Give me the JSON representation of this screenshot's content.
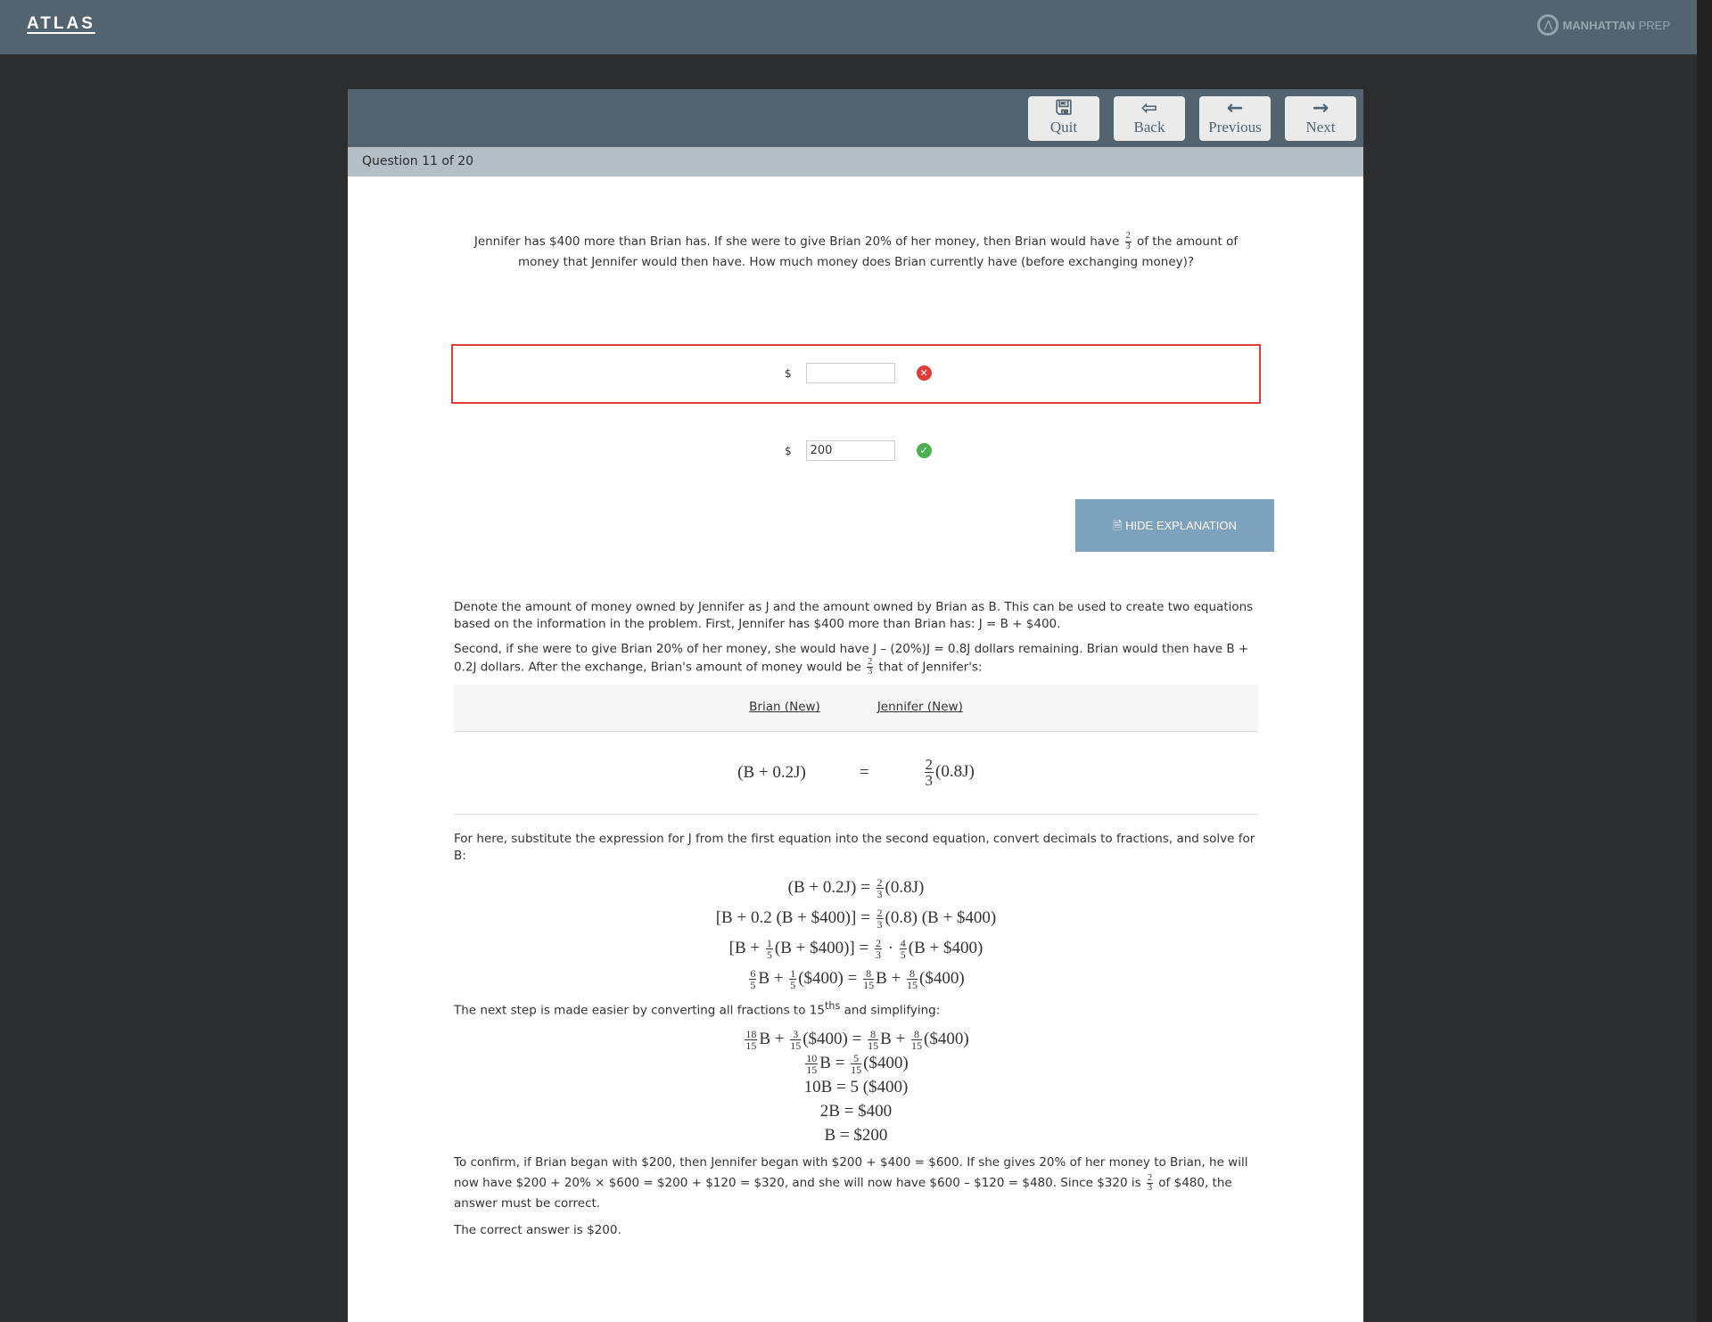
{
  "header": {
    "logo": "ATLAS",
    "brand": "MANHATTAN",
    "brand2": "PREP"
  },
  "toolbar": {
    "quit": "Quit",
    "back": "Back",
    "previous": "Previous",
    "next": "Next"
  },
  "question_bar": {
    "label": "Question 11 of 20"
  },
  "question": {
    "part1": "Jennifer has $400 more than Brian has. If she were to give Brian 20% of her money, then Brian would have",
    "frac_n": "2",
    "frac_d": "3",
    "part2": "of the amount of money that Jennifer would then have. How much money does Brian currently have (before exchanging money)?"
  },
  "answers": [
    {
      "currency": "$",
      "value": "",
      "status": "incorrect"
    },
    {
      "currency": "$",
      "value": "200",
      "status": "correct"
    }
  ],
  "colors": {
    "incorrect": "#e03c3c",
    "correct": "#4caf50",
    "accent": "#7da2bd"
  },
  "hide_button": "HIDE EXPLANATION",
  "explanation": {
    "p1": "Denote the amount of money owned by Jennifer as J and the amount owned by Brian as B. This can be used to create two equations based on the information in the problem. First, Jennifer has $400 more than Brian has: J = B + $400.",
    "p2a": "Second, if she were to give Brian 20% of her money, she would have J – (20%)J = 0.8J dollars remaining. Brian would then have B + 0.2J dollars. After the exchange, Brian's amount of money would be",
    "p2b": "that of Jennifer's:",
    "table": {
      "col1": "Brian (New)",
      "col2": "Jennifer (New)",
      "lhs": "(B + 0.2J)",
      "eq": "=",
      "rhs": "(0.8J)"
    },
    "p3": "For here, substitute the expression for J from the first equation into the second equation, convert decimals to fractions, and solve for B:",
    "eqs1": [
      [
        "(B + 0.2J) = ",
        {
          "n": "2",
          "d": "3"
        },
        "(0.8J)"
      ],
      [
        "[B + 0.2 (B + $400)] = ",
        {
          "n": "2",
          "d": "3"
        },
        "(0.8) (B + $400)"
      ],
      [
        "[B + ",
        {
          "n": "1",
          "d": "5"
        },
        "(B + $400)] = ",
        {
          "n": "2",
          "d": "3"
        },
        " · ",
        {
          "n": "4",
          "d": "5"
        },
        "(B + $400)"
      ],
      [
        {
          "n": "6",
          "d": "5"
        },
        "B + ",
        {
          "n": "1",
          "d": "5"
        },
        "($400) = ",
        {
          "n": "8",
          "d": "15"
        },
        "B + ",
        {
          "n": "8",
          "d": "15"
        },
        "($400)"
      ]
    ],
    "p4a": "The next step is made easier by converting all fractions to 15",
    "p4sup": "ths",
    "p4b": " and simplifying:",
    "eqs2": [
      [
        {
          "n": "18",
          "d": "15"
        },
        "B + ",
        {
          "n": "3",
          "d": "15"
        },
        "($400) = ",
        {
          "n": "8",
          "d": "15"
        },
        "B + ",
        {
          "n": "8",
          "d": "15"
        },
        "($400)"
      ],
      [
        {
          "n": "10",
          "d": "15"
        },
        "B = ",
        {
          "n": "5",
          "d": "15"
        },
        "($400)"
      ],
      [
        "10B = 5 ($400)"
      ],
      [
        "2B = $400"
      ],
      [
        "B = $200"
      ]
    ],
    "p5a": "To confirm, if Brian began with $200, then Jennifer began with $200 + $400 = $600. If she gives 20% of her money to Brian, he will now have $200 + 20% × $600 = $200 + $120 = $320, and she will now have $600 – $120 = $480. Since $320 is",
    "p5b": "of $480, the answer must be correct.",
    "p6": "The correct answer is $200."
  }
}
